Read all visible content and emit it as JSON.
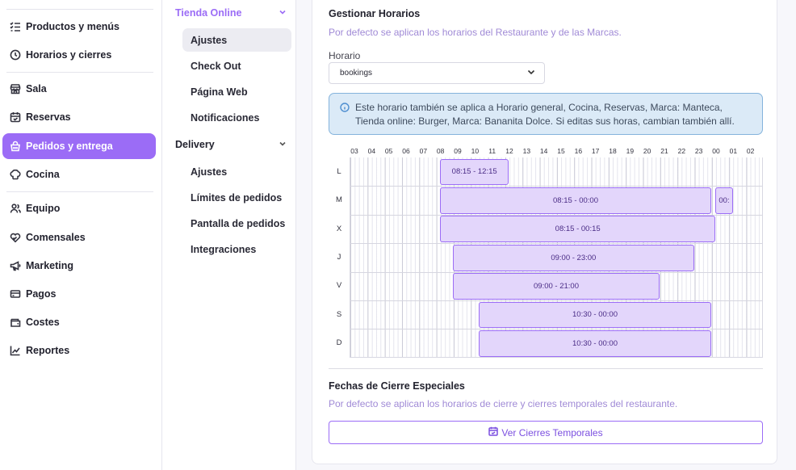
{
  "sidebar": {
    "items": [
      {
        "label": "Productos y menús",
        "icon": "list-check-icon"
      },
      {
        "label": "Horarios y cierres",
        "icon": "clock-icon"
      },
      {
        "label": "Sala",
        "icon": "store-icon"
      },
      {
        "label": "Reservas",
        "icon": "calendar-check-icon"
      },
      {
        "label": "Pedidos y entrega",
        "icon": "bag-icon",
        "active": true
      },
      {
        "label": "Cocina",
        "icon": "chef-hat-icon"
      },
      {
        "label": "Equipo",
        "icon": "users-icon"
      },
      {
        "label": "Comensales",
        "icon": "heart-hand-icon"
      },
      {
        "label": "Marketing",
        "icon": "megaphone-icon"
      },
      {
        "label": "Pagos",
        "icon": "credit-card-icon"
      },
      {
        "label": "Costes",
        "icon": "wallet-icon"
      },
      {
        "label": "Reportes",
        "icon": "chart-icon"
      }
    ]
  },
  "submenu": {
    "group1": {
      "label": "Tienda Online"
    },
    "group1_items": [
      "Ajustes",
      "Check Out",
      "Página Web",
      "Notificaciones"
    ],
    "group2": {
      "label": "Delivery"
    },
    "group2_items": [
      "Ajustes",
      "Límites de pedidos",
      "Pantalla de pedidos",
      "Integraciones"
    ]
  },
  "schedule": {
    "title": "Gestionar Horarios",
    "subtitle": "Por defecto se aplican los horarios del Restaurante y de las Marcas.",
    "horario_label": "Horario",
    "horario_value": "bookings",
    "info": "Este horario también se aplica a Horario general, Cocina, Reservas, Marca: Manteca, Tienda online: Burger, Marca: Bananita Dolce. Si editas sus horas, cambian también allí.",
    "hours": [
      "03",
      "04",
      "05",
      "06",
      "07",
      "08",
      "09",
      "10",
      "11",
      "12",
      "13",
      "14",
      "15",
      "16",
      "17",
      "18",
      "19",
      "20",
      "21",
      "22",
      "23",
      "00",
      "01",
      "02"
    ],
    "days": [
      "L",
      "M",
      "X",
      "J",
      "V",
      "S",
      "D"
    ],
    "blocks": [
      {
        "day": 0,
        "start": 8.25,
        "end": 12.25,
        "label": "08:15 - 12:15"
      },
      {
        "day": 1,
        "start": 8.25,
        "end": 24.0,
        "label": "08:15 - 00:00"
      },
      {
        "day": 1,
        "start": 24.25,
        "end": 25.25,
        "label": "00:"
      },
      {
        "day": 2,
        "start": 8.25,
        "end": 24.25,
        "label": "08:15 - 00:15"
      },
      {
        "day": 3,
        "start": 9.0,
        "end": 23.0,
        "label": "09:00 - 23:00"
      },
      {
        "day": 4,
        "start": 9.0,
        "end": 21.0,
        "label": "09:00 - 21:00"
      },
      {
        "day": 5,
        "start": 10.5,
        "end": 24.0,
        "label": "10:30 - 00:00"
      },
      {
        "day": 6,
        "start": 10.5,
        "end": 24.0,
        "label": "10:30 - 00:00"
      }
    ]
  },
  "closures": {
    "title": "Fechas de Cierre Especiales",
    "subtitle": "Por defecto se aplican los horarios de cierre y cierres temporales del restaurante.",
    "button_label": "Ver Cierres Temporales"
  },
  "colors": {
    "accent": "#9b6cf6",
    "block_fill": "#e3d6fb",
    "info_bg": "#dbeaf7"
  }
}
